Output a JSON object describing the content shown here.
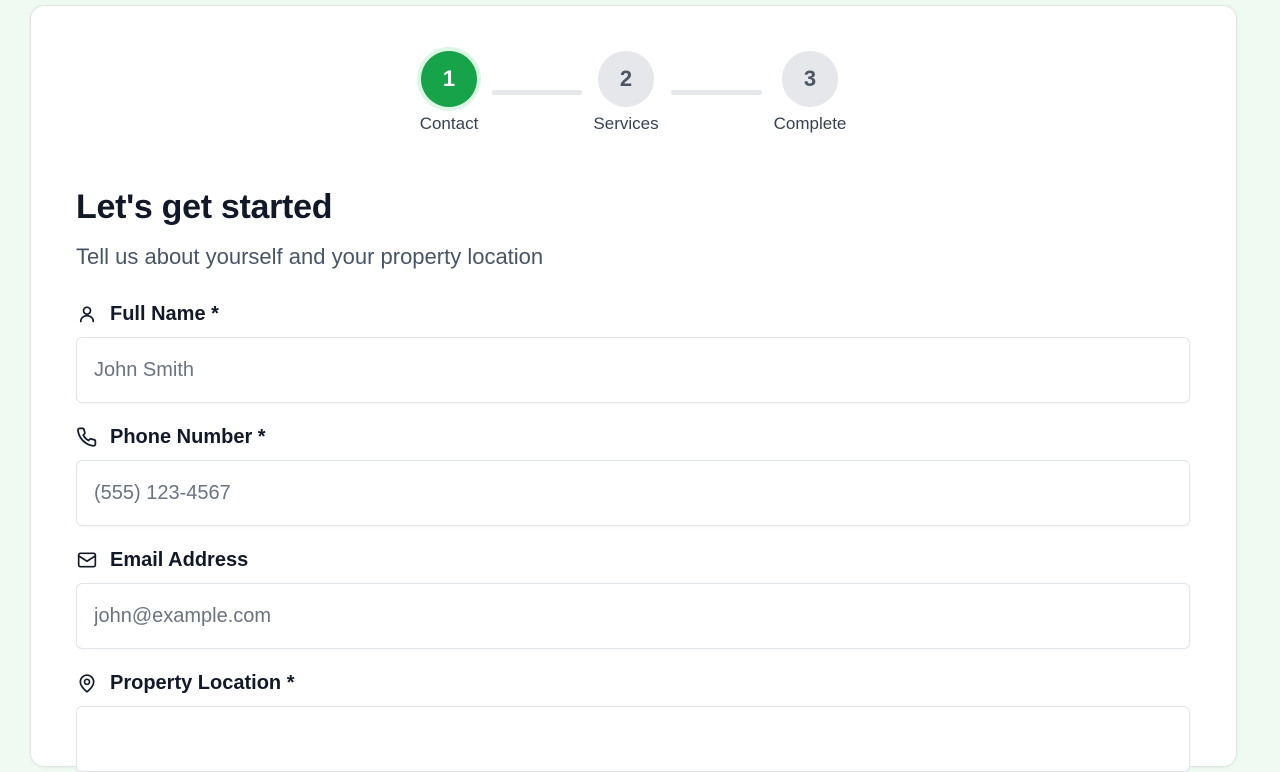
{
  "stepper": {
    "steps": [
      {
        "number": "1",
        "label": "Contact",
        "state": "active"
      },
      {
        "number": "2",
        "label": "Services",
        "state": "inactive"
      },
      {
        "number": "3",
        "label": "Complete",
        "state": "inactive"
      }
    ]
  },
  "form": {
    "title": "Let's get started",
    "subtitle": "Tell us about yourself and your property location",
    "fields": {
      "full_name": {
        "label": "Full Name *",
        "placeholder": "John Smith",
        "value": "",
        "icon": "user-icon"
      },
      "phone": {
        "label": "Phone Number *",
        "placeholder": "(555) 123-4567",
        "value": "",
        "icon": "phone-icon"
      },
      "email": {
        "label": "Email Address",
        "placeholder": "john@example.com",
        "value": "",
        "icon": "mail-icon"
      },
      "location": {
        "label": "Property Location *",
        "placeholder": "",
        "value": "",
        "icon": "map-pin-icon"
      }
    }
  },
  "colors": {
    "accent": "#16a34a",
    "page_background": "#eefaf2",
    "inactive_step": "#e5e7eb"
  }
}
